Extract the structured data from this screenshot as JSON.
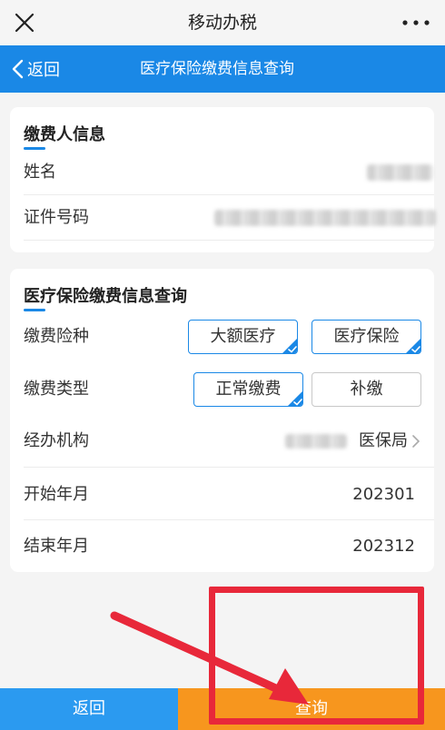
{
  "wechat": {
    "title": "移动办税",
    "close_icon": "close-icon",
    "more_icon": "more-icon"
  },
  "nav": {
    "back_label": "返回",
    "title": "医疗保险缴费信息查询"
  },
  "payer": {
    "section_title": "缴费人信息",
    "name_label": "姓名",
    "id_label": "证件号码"
  },
  "query": {
    "section_title": "医疗保险缴费信息查询",
    "insurance_type_label": "缴费险种",
    "insurance_options": [
      {
        "label": "大额医疗",
        "selected": true
      },
      {
        "label": "医疗保险",
        "selected": true
      }
    ],
    "payment_type_label": "缴费类型",
    "payment_options": [
      {
        "label": "正常缴费",
        "selected": true
      },
      {
        "label": "补缴",
        "selected": false
      }
    ],
    "agency_label": "经办机构",
    "agency_value_suffix": "医保局",
    "start_label": "开始年月",
    "start_value": "202301",
    "end_label": "结束年月",
    "end_value": "202312"
  },
  "footer": {
    "back_label": "返回",
    "query_label": "查询"
  },
  "colors": {
    "primary": "#1a88e6",
    "accent": "#f7961e",
    "annotation": "#e8283a"
  }
}
